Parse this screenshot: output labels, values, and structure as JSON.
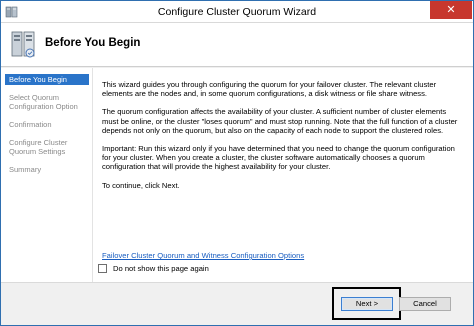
{
  "window": {
    "title": "Configure Cluster Quorum Wizard",
    "close_glyph": "✕",
    "app_icon": "cluster-wizard-icon"
  },
  "header": {
    "title": "Before You Begin",
    "icon": "cluster-servers-icon"
  },
  "sidebar": {
    "items": [
      {
        "label": "Before You Begin",
        "active": true
      },
      {
        "label": "Select Quorum Configuration Option",
        "active": false
      },
      {
        "label": "Confirmation",
        "active": false
      },
      {
        "label": "Configure Cluster Quorum Settings",
        "active": false
      },
      {
        "label": "Summary",
        "active": false
      }
    ]
  },
  "main": {
    "paragraphs": [
      "This wizard guides you through configuring the quorum for your failover cluster. The relevant cluster elements are the nodes and, in some quorum configurations, a disk witness or file share witness.",
      "The quorum configuration affects the availability of your cluster. A sufficient number of cluster elements must be online, or the cluster \"loses quorum\" and must stop running. Note that the full function of a cluster depends not only on the quorum, but also on the capacity of each node to support the clustered roles.",
      "Important: Run this wizard only if you have determined that you need to change the quorum configuration for your cluster. When you create a cluster, the cluster software automatically chooses a quorum configuration that will provide the highest availability for your cluster.",
      "To continue, click Next."
    ],
    "link": "Failover Cluster Quorum and Witness Configuration Options",
    "checkbox_label": "Do not show this page again",
    "checkbox_checked": false
  },
  "footer": {
    "next_label": "Next >",
    "cancel_label": "Cancel"
  },
  "colors": {
    "accent": "#2a74c9",
    "close": "#c7372e",
    "link": "#1a5ec1"
  }
}
